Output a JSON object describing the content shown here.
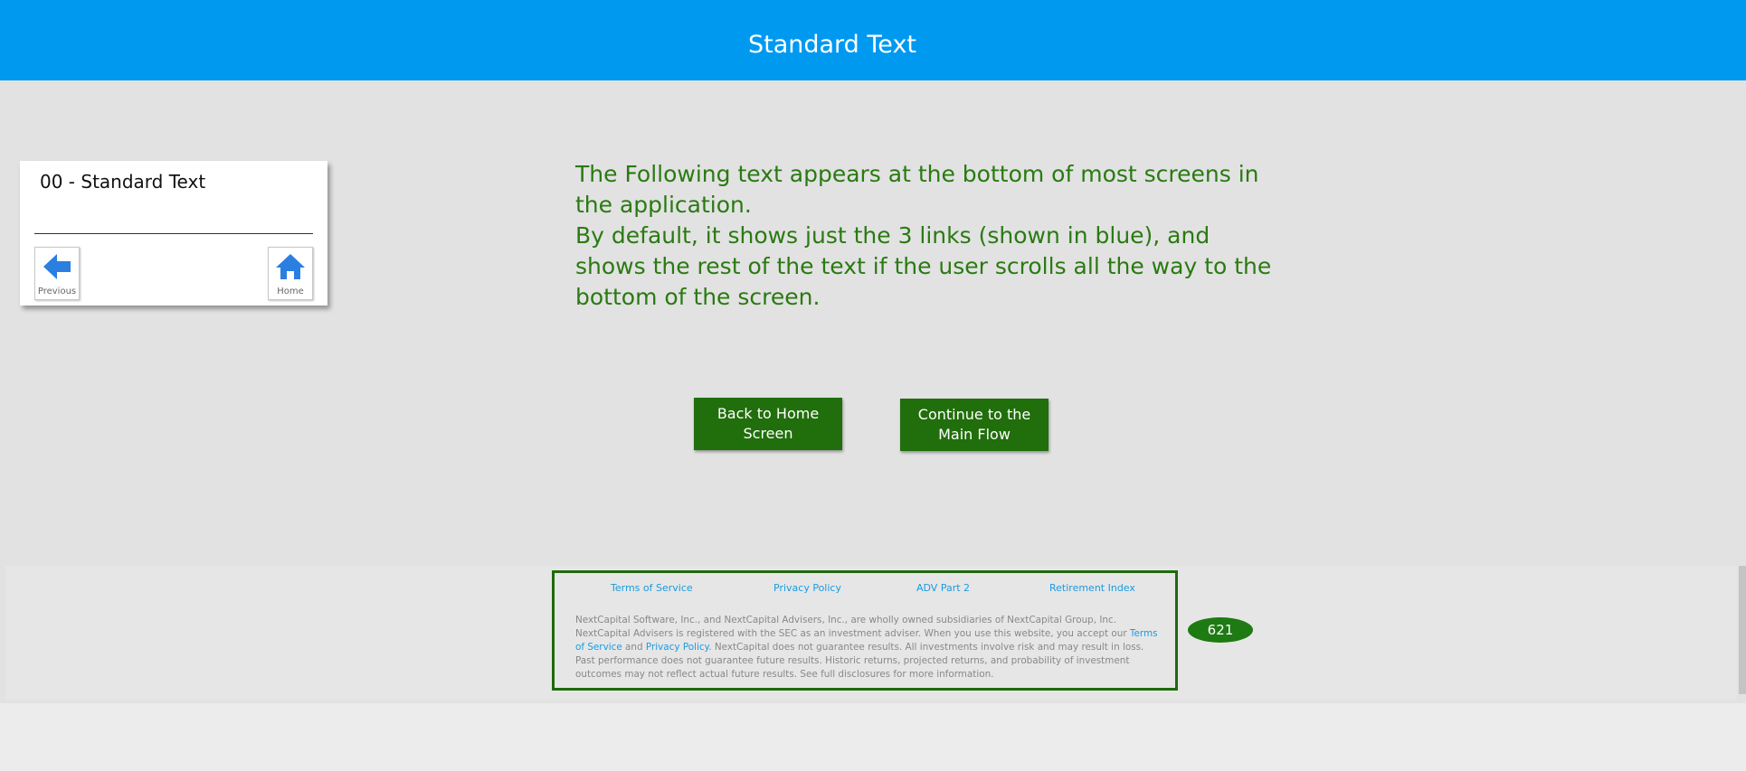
{
  "header": {
    "title": "Standard Text"
  },
  "nav_card": {
    "title": "00 - Standard Text",
    "previous_label": "Previous",
    "home_label": "Home"
  },
  "intro": {
    "line1": "The Following text appears at the bottom of most screens in the application.",
    "line2": "By default, it shows just the 3 links (shown in blue), and shows the rest of the text if the user scrolls all the way to the bottom of the screen."
  },
  "buttons": {
    "back_home": "Back to Home Screen",
    "continue": "Continue to the Main Flow"
  },
  "footer": {
    "links": [
      "Terms of Service",
      "Privacy Policy",
      "ADV Part 2",
      "Retirement Index"
    ],
    "disclaimer_part1": "NextCapital Software, Inc., and NextCapital Advisers, Inc., are wholly owned subsidiaries of NextCapital Group, Inc. NextCapital Advisers is registered with the SEC as an investment adviser. When you use this website, you accept our ",
    "disclaimer_link1": "Terms of Service",
    "disclaimer_and": " and ",
    "disclaimer_link2": "Privacy Policy",
    "disclaimer_part2": ". NextCapital does not guarantee results. All investments involve risk and may result in loss. Past performance does not guarantee future results. Historic returns, projected returns, and probability of investment outcomes may not reflect actual future results. See full disclosures for more information."
  },
  "badge": {
    "value": "621"
  },
  "icons": {
    "previous": "arrow-left-icon",
    "home": "home-icon"
  },
  "colors": {
    "header": "#0099f0",
    "accent_green": "#216e0c",
    "text_green": "#2a7a12",
    "link_blue": "#1a9be0"
  }
}
